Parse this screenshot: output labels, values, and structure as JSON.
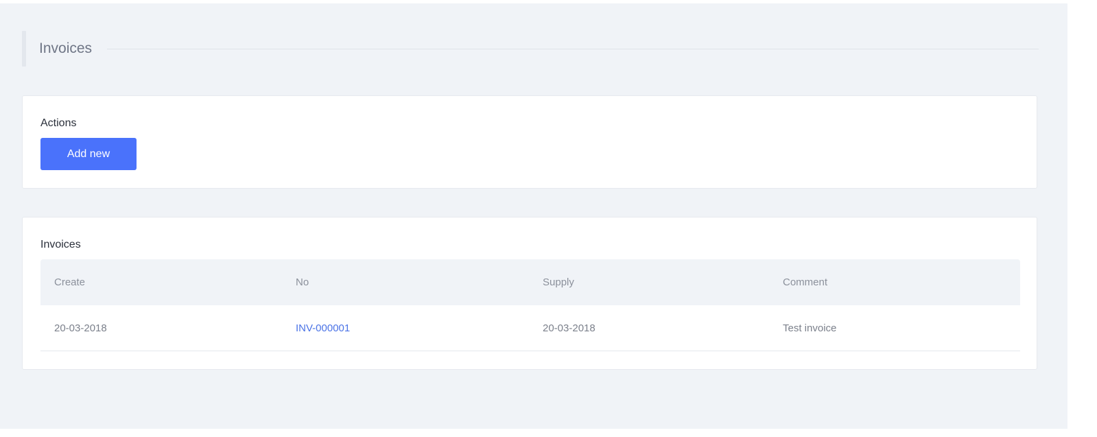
{
  "page": {
    "title": "Invoices"
  },
  "actions_card": {
    "title": "Actions",
    "add_new_label": "Add new"
  },
  "invoices_card": {
    "title": "Invoices",
    "columns": [
      "Create",
      "No",
      "Supply",
      "Comment"
    ],
    "rows": [
      {
        "create": "20-03-2018",
        "no": "INV-000001",
        "supply": "20-03-2018",
        "comment": "Test invoice"
      }
    ]
  },
  "colors": {
    "primary": "#4a72fb",
    "link": "#4b73e6",
    "background": "#f0f3f7"
  }
}
